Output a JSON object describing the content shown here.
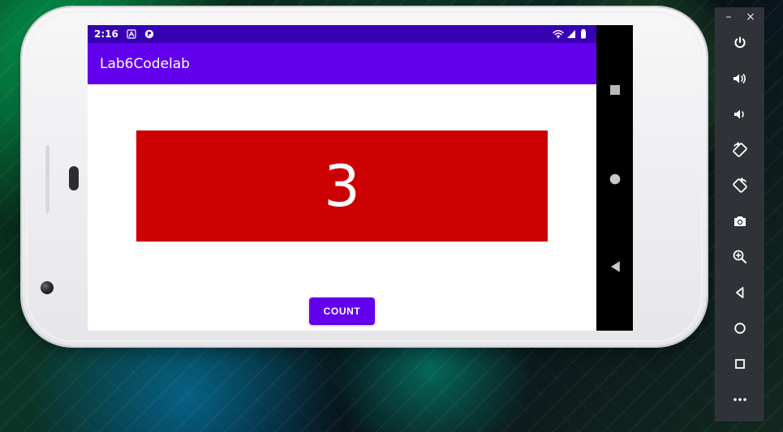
{
  "status_bar": {
    "time": "2:16"
  },
  "app": {
    "title": "Lab6Codelab",
    "count_value": "3",
    "button_label": "COUNT"
  },
  "emulator_panel": {
    "minimize_label": "–",
    "close_label": "×"
  },
  "icons": [
    "notification-a-icon",
    "notification-circle-icon",
    "wifi-icon",
    "signal-icon",
    "battery-icon",
    "recents-icon",
    "home-icon",
    "back-icon",
    "power-icon",
    "volume-up-icon",
    "volume-down-icon",
    "rotate-left-icon",
    "rotate-right-icon",
    "camera-icon",
    "zoom-icon",
    "emulator-back-icon",
    "emulator-home-icon",
    "emulator-overview-icon",
    "more-icon"
  ],
  "colors": {
    "status_bar": "#3700b3",
    "app_bar": "#6200ee",
    "count_box": "#cc0000",
    "button": "#6200ee"
  }
}
